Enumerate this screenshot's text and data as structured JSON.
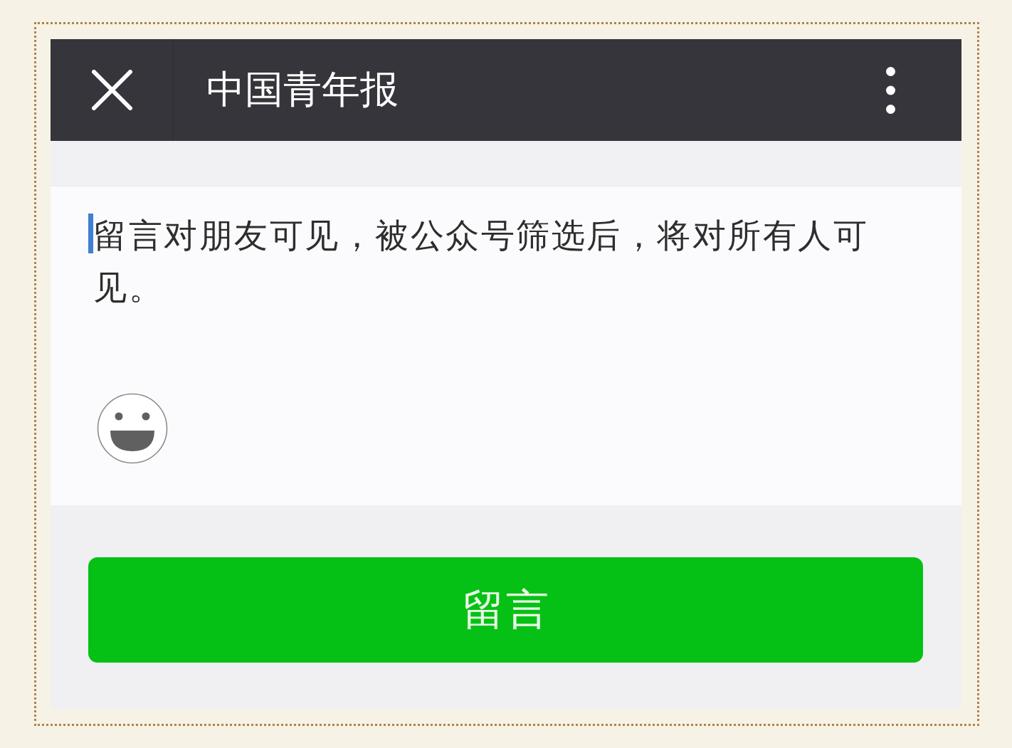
{
  "header": {
    "title": "中国青年报"
  },
  "comment_box": {
    "placeholder": "留言对朋友可见，被公众号筛选后，将对所有人可见。",
    "focused": true
  },
  "submit_button": {
    "label": "留言"
  }
}
